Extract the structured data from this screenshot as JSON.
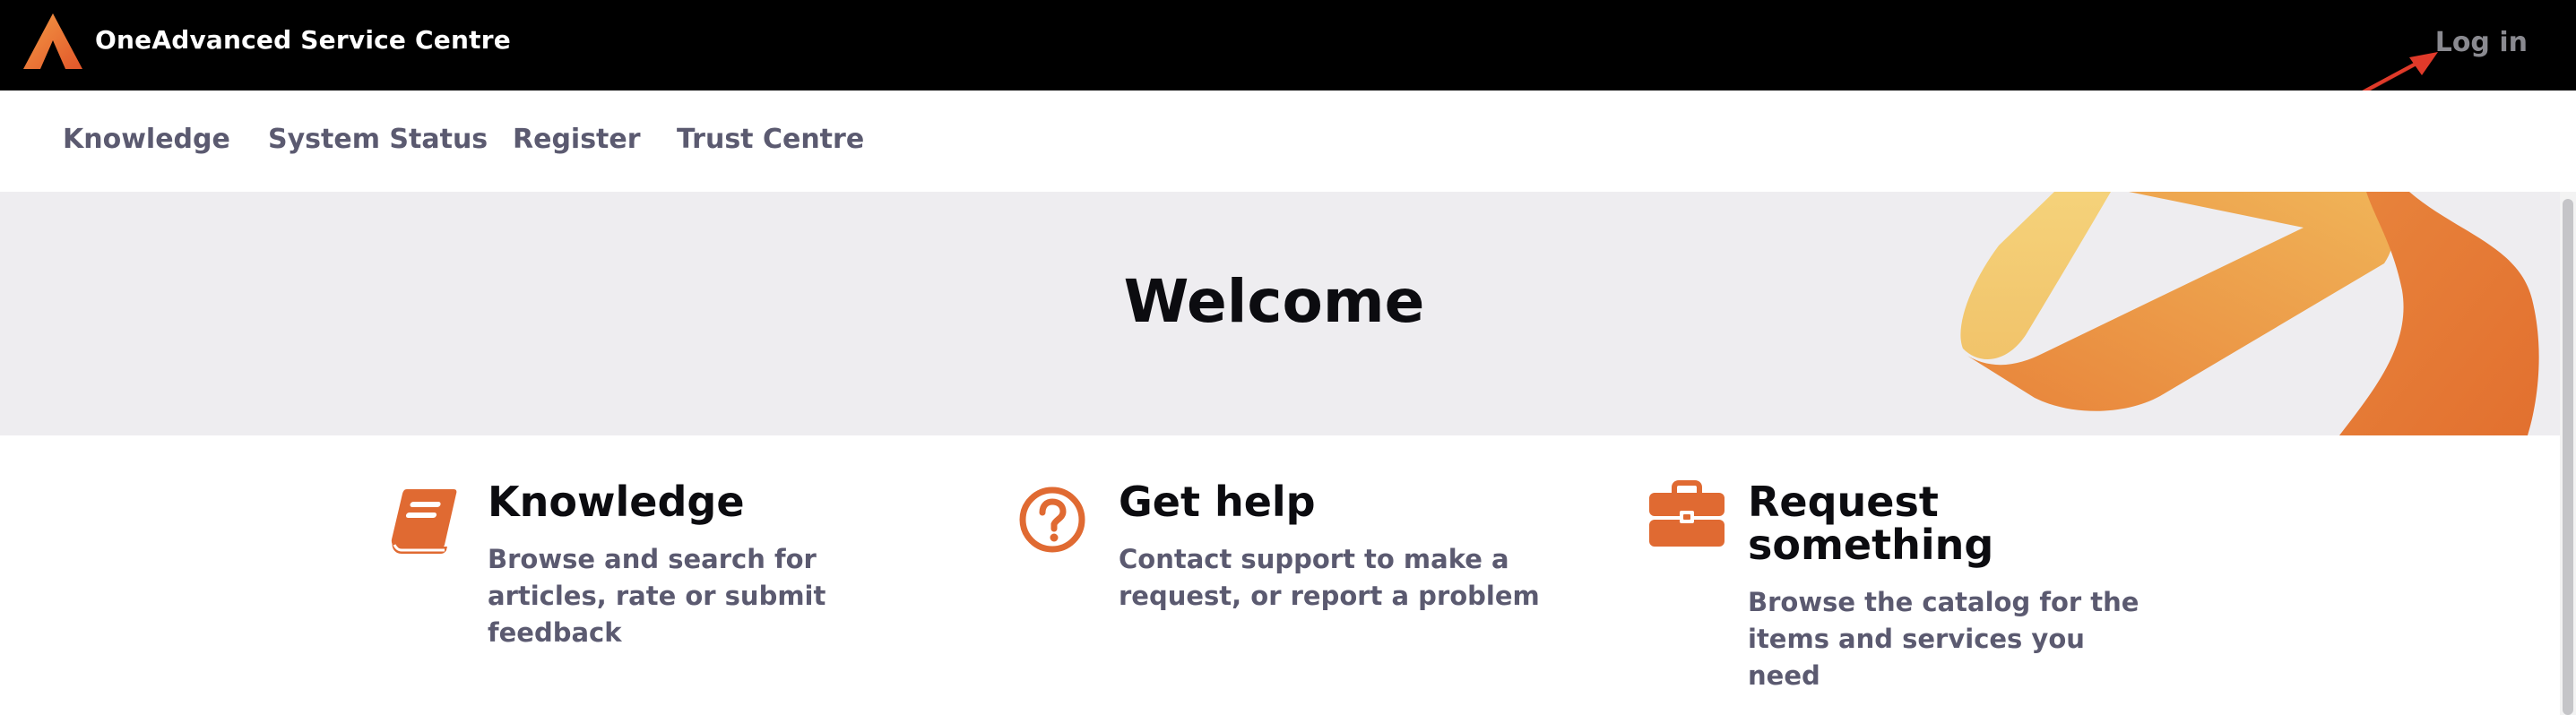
{
  "header": {
    "brand": "OneAdvanced Service Centre",
    "login_label": "Log in"
  },
  "nav": {
    "items": [
      {
        "label": "Knowledge"
      },
      {
        "label": "System Status"
      },
      {
        "label": "Register"
      },
      {
        "label": "Trust Centre"
      }
    ]
  },
  "hero": {
    "title": "Welcome"
  },
  "cards": [
    {
      "icon": "book-icon",
      "title": "Knowledge",
      "description": "Browse and search for articles, rate or submit feedback"
    },
    {
      "icon": "question-circle-icon",
      "title": "Get help",
      "description": "Contact support to make a request, or report a problem"
    },
    {
      "icon": "briefcase-icon",
      "title": "Request something",
      "description": "Browse the catalog for the items and services you need"
    }
  ],
  "colors": {
    "accent": "#e06a32",
    "header_bg": "#000000",
    "hero_bg": "#eeedf0",
    "nav_text": "#5b5a70",
    "annotation_arrow": "#e03a2a"
  }
}
